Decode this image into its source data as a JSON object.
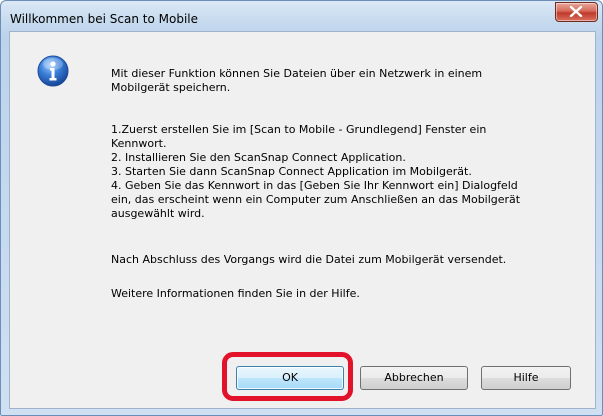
{
  "window": {
    "title": "Willkommen bei Scan to Mobile"
  },
  "icons": {
    "close": "close-icon",
    "info": "info-icon"
  },
  "message": {
    "intro": "Mit dieser Funktion können Sie Dateien über ein Netzwerk in einem\nMobilgerät speichern.",
    "steps": "1.Zuerst erstellen Sie im [Scan to Mobile - Grundlegend] Fenster ein\nKennwort.\n2. Installieren Sie den ScanSnap Connect Application.\n3. Starten Sie dann ScanSnap Connect Application im Mobilgerät.\n4. Geben Sie das Kennwort in das [Geben Sie Ihr Kennwort ein] Dialogfeld\nein, das erscheint wenn ein Computer zum Anschließen an das Mobilgerät\nausgewählt wird.",
    "result": "Nach Abschluss des Vorgangs wird die Datei zum Mobilgerät versendet.",
    "help": "Weitere Informationen finden Sie in der Hilfe."
  },
  "buttons": {
    "ok": "OK",
    "cancel": "Abbrechen",
    "help": "Hilfe"
  },
  "colors": {
    "highlight": "#e3122b",
    "close_button": "#c0392b"
  }
}
